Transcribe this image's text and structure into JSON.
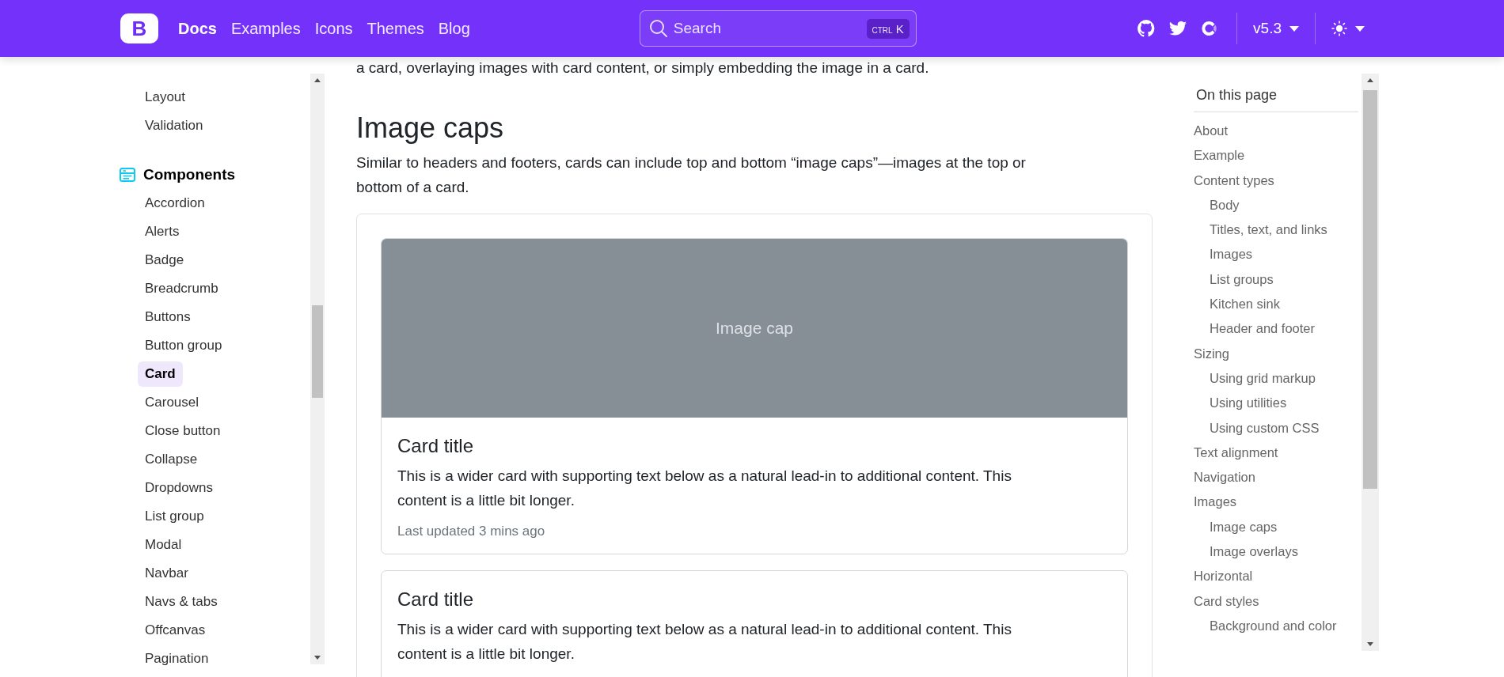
{
  "navbar": {
    "logo_text": "B",
    "links": [
      {
        "label": "Docs",
        "selected": true
      },
      {
        "label": "Examples",
        "selected": false
      },
      {
        "label": "Icons",
        "selected": false
      },
      {
        "label": "Themes",
        "selected": false
      },
      {
        "label": "Blog",
        "selected": false
      }
    ],
    "search": {
      "label": "Search",
      "shortcut_modifier": "CTRL",
      "shortcut_key": "K"
    },
    "version": "v5.3",
    "dark_mode": false
  },
  "sidebar": {
    "groups": [
      {
        "items": [
          {
            "label": "Layout",
            "selected": false
          },
          {
            "label": "Validation",
            "selected": false
          }
        ]
      },
      {
        "title": "Components",
        "items": [
          {
            "label": "Accordion",
            "selected": false
          },
          {
            "label": "Alerts",
            "selected": false
          },
          {
            "label": "Badge",
            "selected": false
          },
          {
            "label": "Breadcrumb",
            "selected": false
          },
          {
            "label": "Buttons",
            "selected": false
          },
          {
            "label": "Button group",
            "selected": false
          },
          {
            "label": "Card",
            "selected": true
          },
          {
            "label": "Carousel",
            "selected": false
          },
          {
            "label": "Close button",
            "selected": false
          },
          {
            "label": "Collapse",
            "selected": false
          },
          {
            "label": "Dropdowns",
            "selected": false
          },
          {
            "label": "List group",
            "selected": false
          },
          {
            "label": "Modal",
            "selected": false
          },
          {
            "label": "Navbar",
            "selected": false
          },
          {
            "label": "Navs & tabs",
            "selected": false
          },
          {
            "label": "Offcanvas",
            "selected": false
          },
          {
            "label": "Pagination",
            "selected": false
          }
        ]
      }
    ]
  },
  "main": {
    "section_intro": "a card, overlaying images with card content, or simply embedding the image in a card.",
    "heading": "Image caps",
    "paragraph": "Similar to headers and footers, cards can include top and bottom “image caps”—images at the top or bottom of a card.",
    "cards": [
      {
        "image_cap": "Image cap",
        "title": "Card title",
        "text": "This is a wider card with supporting text below as a natural lead-in to additional content. This content is a little bit longer.",
        "footnote": "Last updated 3 mins ago"
      },
      {
        "title": "Card title",
        "text": "This is a wider card with supporting text below as a natural lead-in to additional content. This content is a little bit longer."
      }
    ]
  },
  "toc": {
    "title": "On this page",
    "items": [
      {
        "label": "About"
      },
      {
        "label": "Example"
      },
      {
        "label": "Content types",
        "children": [
          {
            "label": "Body"
          },
          {
            "label": "Titles, text, and links"
          },
          {
            "label": "Images"
          },
          {
            "label": "List groups"
          },
          {
            "label": "Kitchen sink"
          },
          {
            "label": "Header and footer"
          }
        ]
      },
      {
        "label": "Sizing",
        "children": [
          {
            "label": "Using grid markup"
          },
          {
            "label": "Using utilities"
          },
          {
            "label": "Using custom CSS"
          }
        ]
      },
      {
        "label": "Text alignment"
      },
      {
        "label": "Navigation"
      },
      {
        "label": "Images",
        "children": [
          {
            "label": "Image caps"
          },
          {
            "label": "Image overlays"
          }
        ]
      },
      {
        "label": "Horizontal"
      },
      {
        "label": "Card styles",
        "children": [
          {
            "label": "Background and color"
          }
        ]
      }
    ]
  }
}
